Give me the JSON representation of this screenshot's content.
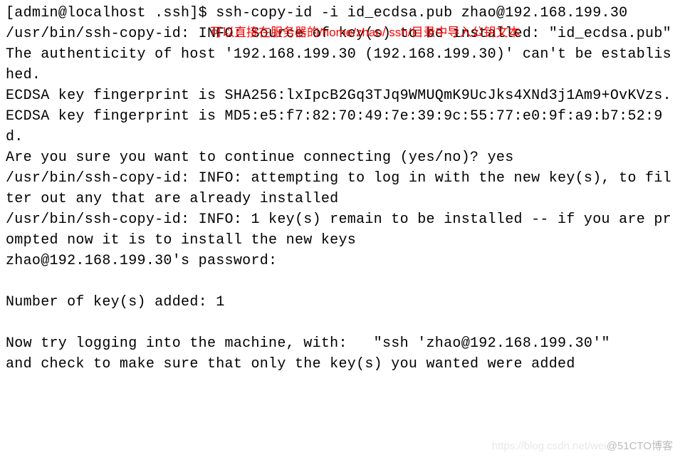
{
  "prompt": "[admin@localhost .ssh]$ ",
  "command": "ssh-copy-id -i id_ecdsa.pub zhao@192.168.199.30",
  "annotation": "可以直接在服务器的/home/zhao/.ssh/目录中导入公钥文本",
  "lines": {
    "l1": "/usr/bin/ssh-copy-id: INFO: Source of key(s) to be installed: \"id_ecdsa.pub\"",
    "l2": "The authenticity of host '192.168.199.30 (192.168.199.30)' can't be established.",
    "l3": "ECDSA key fingerprint is SHA256:lxIpcB2Gq3TJq9WMUQmK9UcJks4XNd3j1Am9+OvKVzs.",
    "l4": "ECDSA key fingerprint is MD5:e5:f7:82:70:49:7e:39:9c:55:77:e0:9f:a9:b7:52:9d.",
    "l5": "Are you sure you want to continue connecting (yes/no)? yes",
    "l6": "/usr/bin/ssh-copy-id: INFO: attempting to log in with the new key(s), to filter out any that are already installed",
    "l7": "/usr/bin/ssh-copy-id: INFO: 1 key(s) remain to be installed -- if you are prompted now it is to install the new keys",
    "l8": "zhao@192.168.199.30's password: ",
    "l9": "",
    "l10": "Number of key(s) added: 1",
    "l11": "",
    "l12": "Now try logging into the machine, with:   \"ssh 'zhao@192.168.199.30'\"",
    "l13": "and check to make sure that only the key(s) you wanted were added"
  },
  "watermark": {
    "faint": "https://blog.csdn.net/wei",
    "main": "@51CTO博客"
  }
}
